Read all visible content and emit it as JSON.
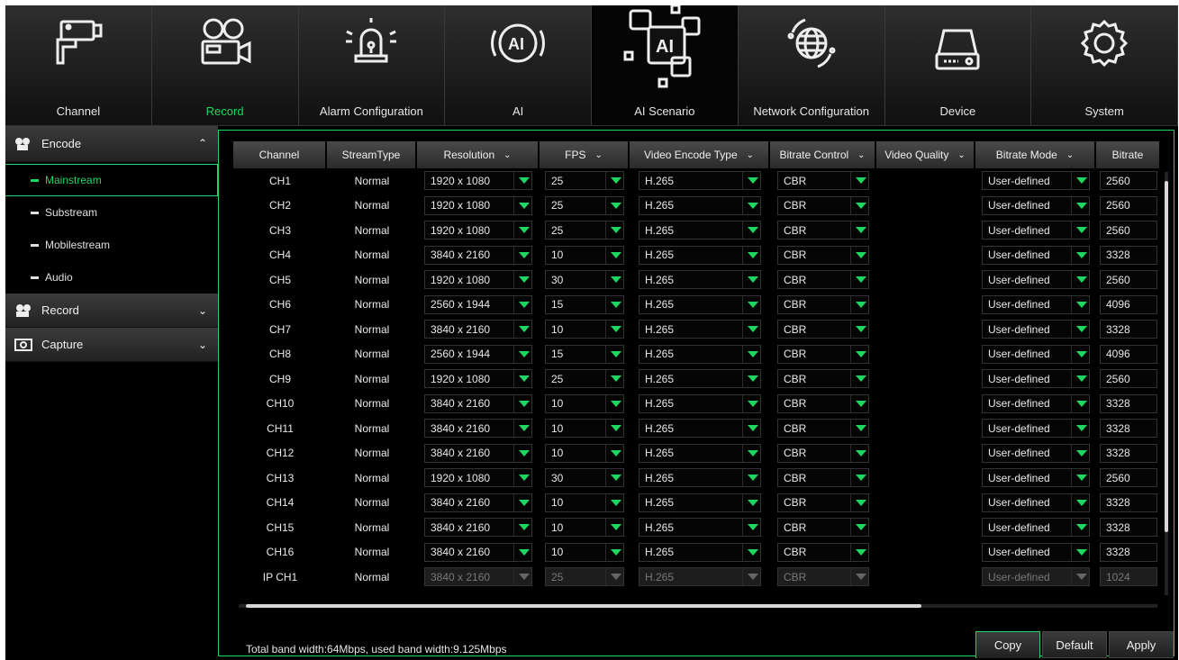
{
  "nav": [
    {
      "label": "Channel",
      "icon": "camera-icon",
      "active": false
    },
    {
      "label": "Record",
      "icon": "video-camera-icon",
      "active": true
    },
    {
      "label": "Alarm Configuration",
      "icon": "alarm-light-icon",
      "active": false
    },
    {
      "label": "AI",
      "icon": "ai-head-icon",
      "active": false
    },
    {
      "label": "AI Scenario",
      "icon": "ai-scenario-icon",
      "active": false
    },
    {
      "label": "Network Configuration",
      "icon": "globe-icon",
      "active": false
    },
    {
      "label": "Device",
      "icon": "hard-disk-icon",
      "active": false
    },
    {
      "label": "System",
      "icon": "gear-icon",
      "active": false
    }
  ],
  "sidebar": {
    "encode": {
      "label": "Encode",
      "icon": "encode-icon",
      "chevron": "^"
    },
    "sub_items": [
      {
        "label": "Mainstream",
        "active": true
      },
      {
        "label": "Substream",
        "active": false
      },
      {
        "label": "Mobilestream",
        "active": false
      },
      {
        "label": "Audio",
        "active": false
      }
    ],
    "record": {
      "label": "Record",
      "icon": "record-icon",
      "chevron": "v"
    },
    "capture": {
      "label": "Capture",
      "icon": "capture-icon",
      "chevron": "v"
    }
  },
  "table": {
    "headers": [
      "Channel",
      "StreamType",
      "Resolution",
      "FPS",
      "Video Encode Type",
      "Bitrate Control",
      "Video Quality",
      "Bitrate Mode",
      "Bitrate"
    ],
    "header_dropdown": [
      false,
      false,
      true,
      true,
      true,
      true,
      true,
      true,
      false
    ],
    "rows": [
      {
        "channel": "CH1",
        "type": "Normal",
        "res": "1920 x 1080",
        "fps": "25",
        "enc": "H.265",
        "ctrl": "CBR",
        "mode": "User-defined",
        "bitrate": "2560",
        "disabled": false
      },
      {
        "channel": "CH2",
        "type": "Normal",
        "res": "1920 x 1080",
        "fps": "25",
        "enc": "H.265",
        "ctrl": "CBR",
        "mode": "User-defined",
        "bitrate": "2560",
        "disabled": false
      },
      {
        "channel": "CH3",
        "type": "Normal",
        "res": "1920 x 1080",
        "fps": "25",
        "enc": "H.265",
        "ctrl": "CBR",
        "mode": "User-defined",
        "bitrate": "2560",
        "disabled": false
      },
      {
        "channel": "CH4",
        "type": "Normal",
        "res": "3840 x 2160",
        "fps": "10",
        "enc": "H.265",
        "ctrl": "CBR",
        "mode": "User-defined",
        "bitrate": "3328",
        "disabled": false
      },
      {
        "channel": "CH5",
        "type": "Normal",
        "res": "1920 x 1080",
        "fps": "30",
        "enc": "H.265",
        "ctrl": "CBR",
        "mode": "User-defined",
        "bitrate": "2560",
        "disabled": false
      },
      {
        "channel": "CH6",
        "type": "Normal",
        "res": "2560 x 1944",
        "fps": "15",
        "enc": "H.265",
        "ctrl": "CBR",
        "mode": "User-defined",
        "bitrate": "4096",
        "disabled": false
      },
      {
        "channel": "CH7",
        "type": "Normal",
        "res": "3840 x 2160",
        "fps": "10",
        "enc": "H.265",
        "ctrl": "CBR",
        "mode": "User-defined",
        "bitrate": "3328",
        "disabled": false
      },
      {
        "channel": "CH8",
        "type": "Normal",
        "res": "2560 x 1944",
        "fps": "15",
        "enc": "H.265",
        "ctrl": "CBR",
        "mode": "User-defined",
        "bitrate": "4096",
        "disabled": false
      },
      {
        "channel": "CH9",
        "type": "Normal",
        "res": "1920 x 1080",
        "fps": "25",
        "enc": "H.265",
        "ctrl": "CBR",
        "mode": "User-defined",
        "bitrate": "2560",
        "disabled": false
      },
      {
        "channel": "CH10",
        "type": "Normal",
        "res": "3840 x 2160",
        "fps": "10",
        "enc": "H.265",
        "ctrl": "CBR",
        "mode": "User-defined",
        "bitrate": "3328",
        "disabled": false
      },
      {
        "channel": "CH11",
        "type": "Normal",
        "res": "3840 x 2160",
        "fps": "10",
        "enc": "H.265",
        "ctrl": "CBR",
        "mode": "User-defined",
        "bitrate": "3328",
        "disabled": false
      },
      {
        "channel": "CH12",
        "type": "Normal",
        "res": "3840 x 2160",
        "fps": "10",
        "enc": "H.265",
        "ctrl": "CBR",
        "mode": "User-defined",
        "bitrate": "3328",
        "disabled": false
      },
      {
        "channel": "CH13",
        "type": "Normal",
        "res": "1920 x 1080",
        "fps": "30",
        "enc": "H.265",
        "ctrl": "CBR",
        "mode": "User-defined",
        "bitrate": "2560",
        "disabled": false
      },
      {
        "channel": "CH14",
        "type": "Normal",
        "res": "3840 x 2160",
        "fps": "10",
        "enc": "H.265",
        "ctrl": "CBR",
        "mode": "User-defined",
        "bitrate": "3328",
        "disabled": false
      },
      {
        "channel": "CH15",
        "type": "Normal",
        "res": "3840 x 2160",
        "fps": "10",
        "enc": "H.265",
        "ctrl": "CBR",
        "mode": "User-defined",
        "bitrate": "3328",
        "disabled": false
      },
      {
        "channel": "CH16",
        "type": "Normal",
        "res": "3840 x 2160",
        "fps": "10",
        "enc": "H.265",
        "ctrl": "CBR",
        "mode": "User-defined",
        "bitrate": "3328",
        "disabled": false
      },
      {
        "channel": "IP CH1",
        "type": "Normal",
        "res": "3840 x 2160",
        "fps": "25",
        "enc": "H.265",
        "ctrl": "CBR",
        "mode": "User-defined",
        "bitrate": "1024",
        "disabled": true
      }
    ]
  },
  "footer": {
    "bandwidth_text": "Total band width:64Mbps, used band width:9.125Mbps",
    "buttons": [
      "Copy",
      "Default",
      "Apply"
    ]
  },
  "colors": {
    "accent": "#1ed760",
    "background": "#000000",
    "header": "#3a3a3a"
  }
}
